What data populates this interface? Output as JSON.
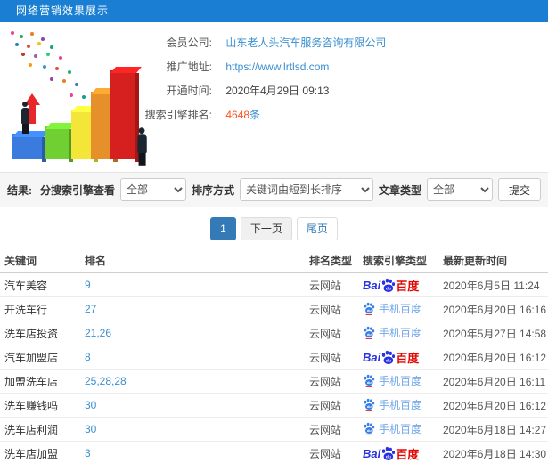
{
  "colors": {
    "header_bg": "#1a7fd2",
    "link_blue": "#3a8fd0",
    "count_red": "#ff5222",
    "active_page_blue": "#337ab7",
    "baidu_blue": "#2932e1",
    "baidu_red": "#e10601",
    "mobile_baidu_blue": "#3a7fe8"
  },
  "header": {
    "title": "网络营销效果展示"
  },
  "info": {
    "rows": [
      {
        "label": "会员公司:",
        "value": "山东老人头汽车服务咨询有限公司"
      },
      {
        "label": "推广地址:",
        "value": "https://www.lrtlsd.com"
      },
      {
        "label": "开通时间:",
        "value": "2020年4月29日 09:13"
      },
      {
        "label": "搜索引擎排名:",
        "value": "4648",
        "unit": "条"
      }
    ]
  },
  "filters": {
    "result_label": "结果:",
    "engine_view_label": "分搜索引擎查看",
    "engine_view_value": "全部",
    "sort_label": "排序方式",
    "sort_value": "关键词由短到长排序",
    "article_type_label": "文章类型",
    "article_type_value": "全部",
    "submit_label": "提交"
  },
  "pagination": {
    "current": "1",
    "next": "下一页",
    "last": "尾页"
  },
  "table": {
    "headers": [
      "关键词",
      "排名",
      "排名类型",
      "搜索引擎类型",
      "最新更新时间"
    ],
    "engine_logos": {
      "baidu": {
        "prefix": "Bai",
        "suffix": "百度"
      },
      "mobile": {
        "label": "手机百度"
      }
    },
    "rows": [
      {
        "keyword": "汽车美容",
        "rank": "9",
        "rank_type": "云网站",
        "engine": "baidu",
        "updated": "2020年6月5日 11:24"
      },
      {
        "keyword": "开洗车行",
        "rank": "27",
        "rank_type": "云网站",
        "engine": "mobile-baidu",
        "updated": "2020年6月20日 16:16"
      },
      {
        "keyword": "洗车店投资",
        "rank": "21,26",
        "rank_type": "云网站",
        "engine": "mobile-baidu",
        "updated": "2020年5月27日 14:58"
      },
      {
        "keyword": "汽车加盟店",
        "rank": "8",
        "rank_type": "云网站",
        "engine": "baidu",
        "updated": "2020年6月20日 16:12"
      },
      {
        "keyword": "加盟洗车店",
        "rank": "25,28,28",
        "rank_type": "云网站",
        "engine": "mobile-baidu",
        "updated": "2020年6月20日 16:11"
      },
      {
        "keyword": "洗车赚钱吗",
        "rank": "30",
        "rank_type": "云网站",
        "engine": "mobile-baidu",
        "updated": "2020年6月20日 16:12"
      },
      {
        "keyword": "洗车店利润",
        "rank": "30",
        "rank_type": "云网站",
        "engine": "mobile-baidu",
        "updated": "2020年6月18日 14:27"
      },
      {
        "keyword": "洗车店加盟",
        "rank": "3",
        "rank_type": "云网站",
        "engine": "baidu",
        "updated": "2020年6月18日 14:30"
      }
    ]
  }
}
